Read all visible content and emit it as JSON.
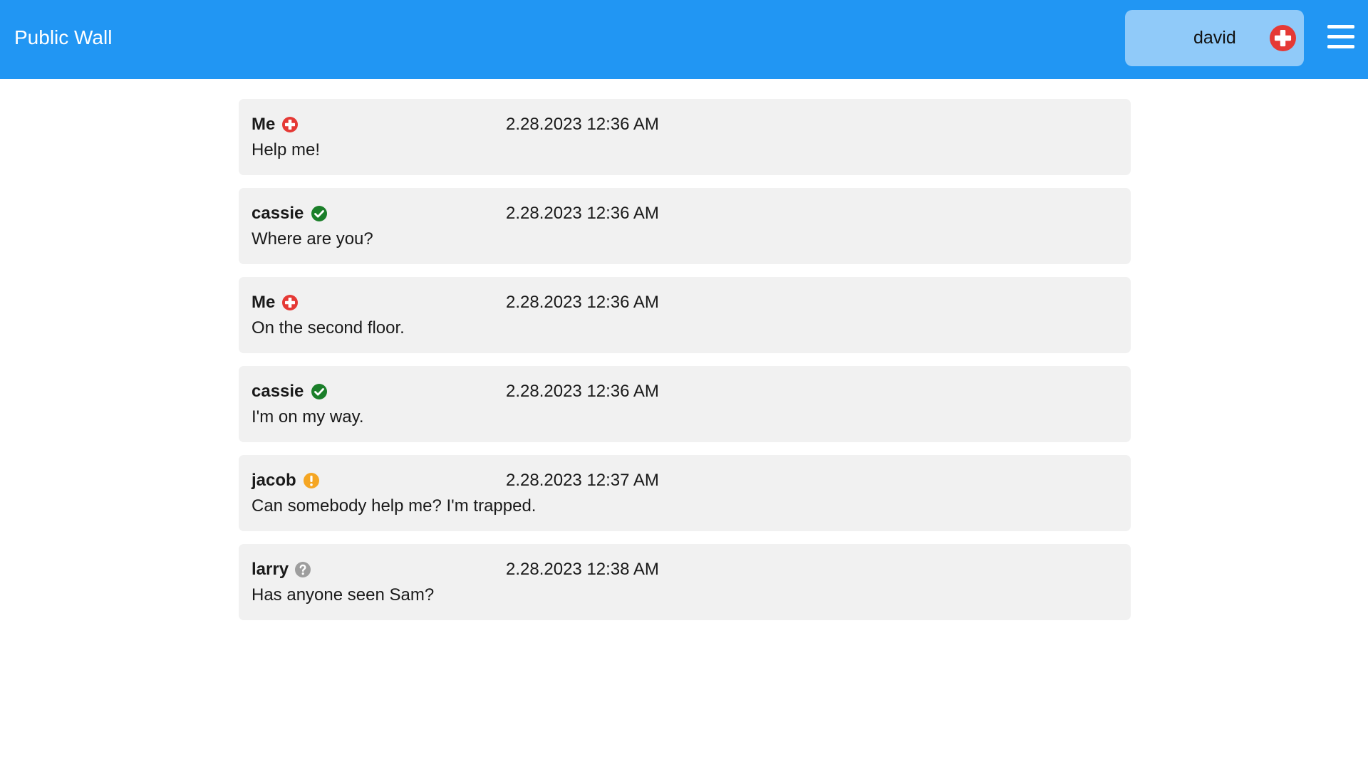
{
  "header": {
    "title": "Public Wall",
    "user": {
      "name": "david",
      "status_icon": "red-cross-icon"
    },
    "menu_icon": "hamburger-menu-icon",
    "background": "#2196F3",
    "chip_background": "#90CAF9"
  },
  "status_colors": {
    "emergency": "#E53935",
    "ok": "#1B7F2A",
    "help": "#F5A623",
    "undefined": "#9E9E9E"
  },
  "messages": [
    {
      "author": "Me",
      "status": "emergency",
      "status_icon": "red-cross-icon",
      "timestamp": "2.28.2023 12:36 AM",
      "text": "Help me!"
    },
    {
      "author": "cassie",
      "status": "ok",
      "status_icon": "green-check-icon",
      "timestamp": "2.28.2023 12:36 AM",
      "text": "Where are you?"
    },
    {
      "author": "Me",
      "status": "emergency",
      "status_icon": "red-cross-icon",
      "timestamp": "2.28.2023 12:36 AM",
      "text": "On the second floor."
    },
    {
      "author": "cassie",
      "status": "ok",
      "status_icon": "green-check-icon",
      "timestamp": "2.28.2023 12:36 AM",
      "text": "I'm on my way."
    },
    {
      "author": "jacob",
      "status": "help",
      "status_icon": "orange-exclamation-icon",
      "timestamp": "2.28.2023 12:37 AM",
      "text": "Can somebody help me? I'm trapped."
    },
    {
      "author": "larry",
      "status": "undefined",
      "status_icon": "grey-question-icon",
      "timestamp": "2.28.2023 12:38 AM",
      "text": "Has anyone seen Sam?"
    }
  ]
}
